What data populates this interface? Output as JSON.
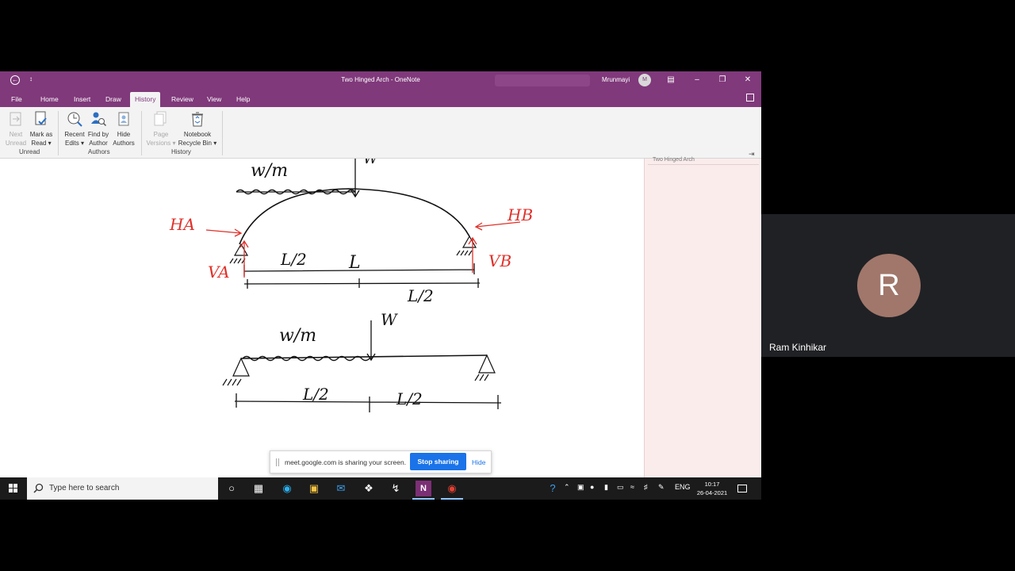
{
  "onenote": {
    "title": "Two Hinged Arch - OneNote",
    "user": "Mrunmayi",
    "avatar_initial": "M",
    "qat_glyph": "↕",
    "menu_tabs": [
      "File",
      "Home",
      "Insert",
      "Draw",
      "History",
      "Review",
      "View",
      "Help"
    ],
    "active_tab": "History",
    "ribbon": {
      "next_unread": [
        "Next",
        "Unread"
      ],
      "mark_as_read": [
        "Mark as",
        "Read ▾"
      ],
      "recent_edits": [
        "Recent",
        "Edits ▾"
      ],
      "find_by_author": [
        "Find by",
        "Author"
      ],
      "hide_authors": [
        "Hide",
        "Authors"
      ],
      "page_versions": [
        "Page",
        "Versions ▾"
      ],
      "notebook_recycle_bin": [
        "Notebook",
        "Recycle Bin ▾"
      ],
      "groups": [
        "Unread",
        "Authors",
        "History"
      ]
    },
    "page_panel_title": "Two Hinged Arch"
  },
  "sketch": {
    "upper": {
      "load_udl": "w/m",
      "load_point": "W",
      "reaction_ha": "HA",
      "reaction_hb": "HB",
      "reaction_va": "VA",
      "reaction_vb": "VB",
      "half_span_left": "L/2",
      "span": "L",
      "half_span_right": "L/2"
    },
    "lower": {
      "load_udl": "w/m",
      "load_point": "W",
      "half_span_left": "L/2",
      "half_span_right": "L/2"
    }
  },
  "share_bar": {
    "message": "meet.google.com is sharing your screen.",
    "stop_button": "Stop sharing",
    "hide_link": "Hide"
  },
  "taskbar": {
    "search_placeholder": "Type here to search",
    "language": "ENG",
    "time": "10:17",
    "date": "26-04-2021"
  },
  "participant": {
    "initial": "R",
    "name": "Ram Kinhikar"
  },
  "colors": {
    "onenote_purple": "#80397b",
    "ink_red": "#e0302a",
    "meet_blue": "#1a73e8",
    "avatar_brown": "#a1776b"
  }
}
